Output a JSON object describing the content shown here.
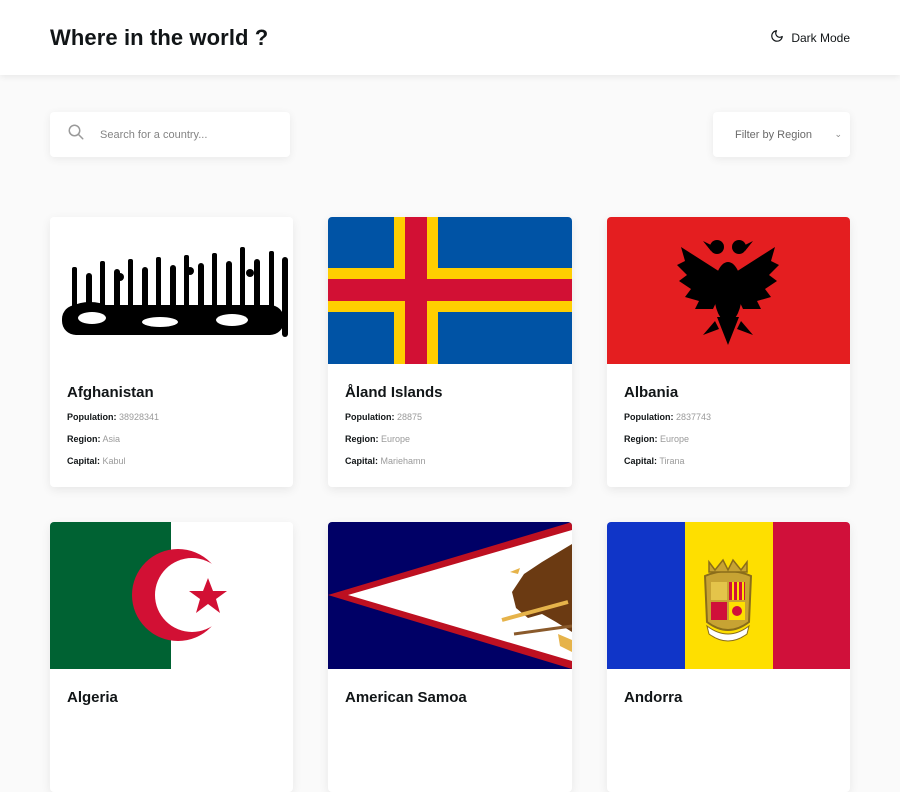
{
  "header": {
    "title": "Where in the world ?",
    "dark_mode_label": "Dark Mode"
  },
  "search": {
    "placeholder": "Search for a country..."
  },
  "filter": {
    "label": "Filter by Region"
  },
  "labels": {
    "population": "Population:",
    "region": "Region:",
    "capital": "Capital:"
  },
  "countries": [
    {
      "name": "Afghanistan",
      "population": "38928341",
      "region": "Asia",
      "capital": "Kabul"
    },
    {
      "name": "Åland Islands",
      "population": "28875",
      "region": "Europe",
      "capital": "Mariehamn"
    },
    {
      "name": "Albania",
      "population": "2837743",
      "region": "Europe",
      "capital": "Tirana"
    },
    {
      "name": "Algeria",
      "population": "",
      "region": "",
      "capital": ""
    },
    {
      "name": "American Samoa",
      "population": "",
      "region": "",
      "capital": ""
    },
    {
      "name": "Andorra",
      "population": "",
      "region": "",
      "capital": ""
    }
  ],
  "colors": {
    "background": "#fafafa",
    "card": "#ffffff",
    "text": "#111517",
    "muted": "#9a9a9a"
  }
}
